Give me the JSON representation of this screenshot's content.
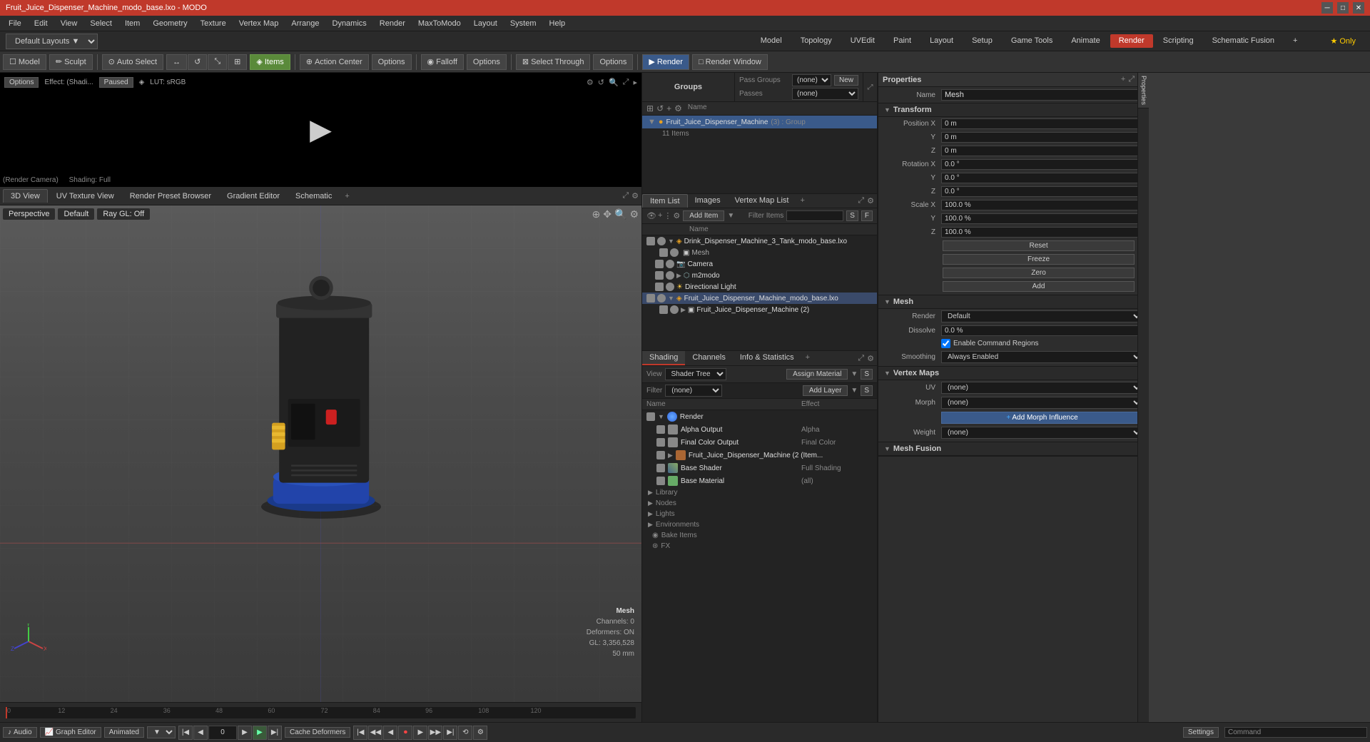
{
  "titlebar": {
    "title": "Fruit_Juice_Dispenser_Machine_modo_base.lxo - MODO",
    "controls": [
      "─",
      "□",
      "✕"
    ]
  },
  "menubar": {
    "items": [
      "File",
      "Edit",
      "View",
      "Select",
      "Item",
      "Geometry",
      "Texture",
      "Vertex Map",
      "Arrange",
      "Dynamics",
      "Render",
      "MaxToModo",
      "Layout",
      "System",
      "Help"
    ]
  },
  "layoutbar": {
    "dropdown": "Default Layouts ▼",
    "tabs": [
      "Model",
      "Topology",
      "UVEdit",
      "Paint",
      "Layout",
      "Setup",
      "Game Tools",
      "Animate",
      "Render",
      "Scripting",
      "Schematic Fusion",
      "+"
    ],
    "active_tab": "Render",
    "only_btn": "Only"
  },
  "toolbar": {
    "model_btn": "Model",
    "sculpt_btn": "Sculpt",
    "auto_select": "Auto Select",
    "items_btn": "Items",
    "action_center_btn": "Action Center",
    "options_btn1": "Options",
    "falloff_btn": "Falloff",
    "options_btn2": "Options",
    "select_through": "Select Through",
    "options_btn3": "Options",
    "render_btn": "Render",
    "render_window_btn": "Render Window"
  },
  "video_preview": {
    "effect": "Effect: (Shadi...",
    "status": "Paused",
    "lut": "LUT: sRGB",
    "camera": "(Render Camera)",
    "shading": "Shading: Full"
  },
  "view_tabs": {
    "tabs": [
      "3D View",
      "UV Texture View",
      "Render Preset Browser",
      "Gradient Editor",
      "Schematic"
    ],
    "active": "3D View",
    "add": "+"
  },
  "viewport": {
    "perspective": "Perspective",
    "default": "Default",
    "ray_gl": "Ray GL: Off",
    "mesh_label": "Mesh",
    "channels": "Channels: 0",
    "deformers": "Deformers: ON",
    "gl_info": "GL: 3,356,528",
    "focal": "50 mm"
  },
  "timeline": {
    "ticks": [
      "0",
      "12",
      "24",
      "36",
      "48",
      "60",
      "72",
      "84",
      "96",
      "108",
      "120"
    ],
    "end_tick": "120"
  },
  "groups_panel": {
    "title": "Groups",
    "pass_groups_label": "Pass Groups",
    "passes_label": "Passes",
    "pass_groups_val": "(none)",
    "passes_val": "(none)",
    "new_btn": "New",
    "group_name": "Fruit_Juice_Dispenser_Machine",
    "group_type": "(3) : Group",
    "group_items": "11 Items"
  },
  "items_panel": {
    "tabs": [
      "Item List",
      "Images",
      "Vertex Map List",
      "+"
    ],
    "active_tab": "Item List",
    "add_item_btn": "Add Item",
    "filter_label": "Filter Items",
    "items": [
      {
        "name": "Drink_Dispenser_Machine_3_Tank_modo_base.lxo",
        "level": 0,
        "type": "file",
        "visible": true
      },
      {
        "name": "Mesh",
        "level": 1,
        "type": "mesh",
        "visible": true
      },
      {
        "name": "Camera",
        "level": 1,
        "type": "camera",
        "visible": true
      },
      {
        "name": "m2modo",
        "level": 1,
        "type": "group",
        "visible": true
      },
      {
        "name": "Directional Light",
        "level": 1,
        "type": "light",
        "visible": true
      },
      {
        "name": "Fruit_Juice_Dispenser_Machine_modo_base.lxo",
        "level": 0,
        "type": "file",
        "visible": true,
        "selected": true
      },
      {
        "name": "Fruit_Juice_Dispenser_Machine (2)",
        "level": 1,
        "type": "mesh",
        "visible": true
      }
    ]
  },
  "shading_panel": {
    "tabs": [
      "Shading",
      "Channels",
      "Info & Statistics",
      "+"
    ],
    "active_tab": "Shading",
    "view_label": "View",
    "shader_tree": "Shader Tree",
    "assign_material": "Assign Material",
    "add_layer": "Add Layer",
    "filter_label": "(none)",
    "shader_items": [
      {
        "name": "Render",
        "effect": "",
        "level": 0,
        "type": "render"
      },
      {
        "name": "Alpha Output",
        "effect": "Alpha",
        "level": 1,
        "type": "output"
      },
      {
        "name": "Final Color Output",
        "effect": "Final Color",
        "level": 1,
        "type": "output"
      },
      {
        "name": "Fruit_Juice_Dispenser_Machine (2 (Item...",
        "effect": "",
        "level": 1,
        "type": "material"
      },
      {
        "name": "Base Shader",
        "effect": "Full Shading",
        "level": 1,
        "type": "shader"
      },
      {
        "name": "Base Material",
        "effect": "(all)",
        "level": 1,
        "type": "base"
      },
      {
        "name": "Library",
        "effect": "",
        "level": 0,
        "type": "section"
      },
      {
        "name": "Nodes",
        "effect": "",
        "level": 0,
        "type": "section"
      },
      {
        "name": "Lights",
        "effect": "",
        "level": 0,
        "type": "section"
      },
      {
        "name": "Environments",
        "effect": "",
        "level": 0,
        "type": "section"
      },
      {
        "name": "Bake Items",
        "effect": "",
        "level": 0,
        "type": "section"
      },
      {
        "name": "FX",
        "effect": "",
        "level": 0,
        "type": "section"
      }
    ]
  },
  "properties": {
    "title": "Properties",
    "name_label": "Name",
    "name_val": "Mesh",
    "transform_title": "Transform",
    "position": {
      "x": "0 m",
      "y": "0 m",
      "z": "0 m"
    },
    "rotation": {
      "x": "0.0 °",
      "y": "0.0 °",
      "z": "0.0 °"
    },
    "scale": {
      "x": "100.0 %",
      "y": "100.0 %",
      "z": "100.0 %"
    },
    "reset_btn": "Reset",
    "freeze_btn": "Freeze",
    "zero_btn": "Zero",
    "add_btn": "Add",
    "mesh_title": "Mesh",
    "render_label": "Render",
    "render_val": "Default",
    "dissolve_label": "Dissolve",
    "dissolve_val": "0.0 %",
    "enable_cmd": "Enable Command Regions",
    "smoothing_label": "Smoothing",
    "smoothing_val": "Always Enabled",
    "vertex_maps_title": "Vertex Maps",
    "uv_label": "UV",
    "uv_val": "(none)",
    "morph_label": "Morph",
    "morph_val": "(none)",
    "add_morph_btn": "Add Morph Influence",
    "weight_label": "Weight",
    "weight_val": "(none)",
    "mesh_fusion_title": "Mesh Fusion"
  },
  "bottom_bar": {
    "audio_btn": "Audio",
    "graph_editor_btn": "Graph Editor",
    "animated_btn": "Animated",
    "cache_deformers_btn": "Cache Deformers",
    "play_btn": "Play",
    "settings_btn": "Settings",
    "frame_input": "0"
  }
}
